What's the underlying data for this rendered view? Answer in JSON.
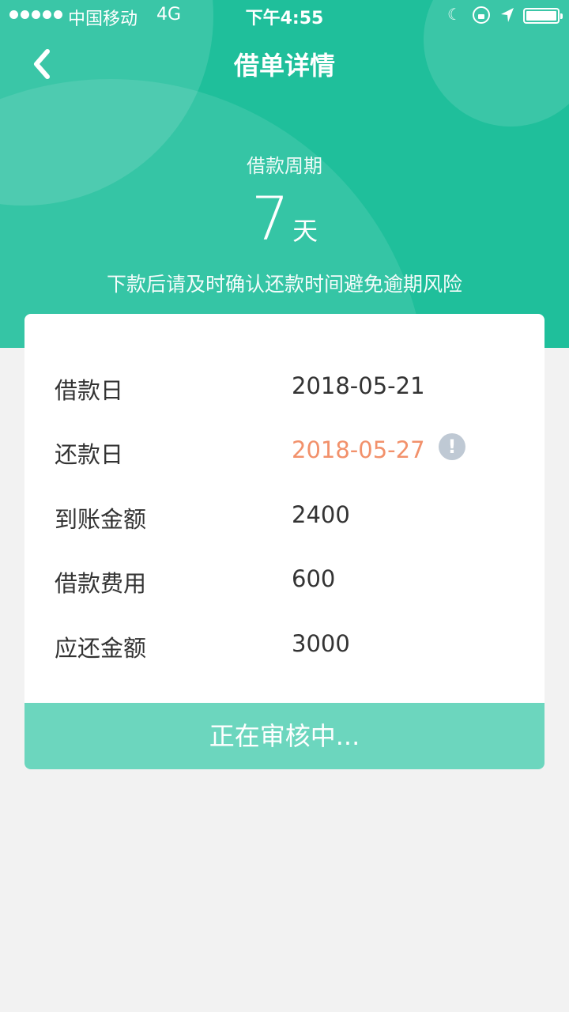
{
  "status_bar": {
    "carrier": "中国移动",
    "network": "4G",
    "time": "下午4:55"
  },
  "nav": {
    "title": "借单详情",
    "back_icon": "chevron-left-icon"
  },
  "summary": {
    "period_label": "借款周期",
    "period_value": "7",
    "period_unit": "天",
    "hint": "下款后请及时确认还款时间避免逾期风险"
  },
  "details": [
    {
      "label": "借款日",
      "value": "2018-05-21"
    },
    {
      "label": "还款日",
      "value": "2018-05-27"
    },
    {
      "label": "到账金额",
      "value": "2400"
    },
    {
      "label": "借款费用",
      "value": "600"
    },
    {
      "label": "应还金额",
      "value": "3000"
    }
  ],
  "warn_icon": {
    "glyph": "!"
  },
  "action": {
    "label": "正在审核中..."
  },
  "colors": {
    "brand": "#1fbf9b",
    "button": "#6cd6be",
    "due_date": "#f2916b",
    "background": "#f2f2f2"
  }
}
